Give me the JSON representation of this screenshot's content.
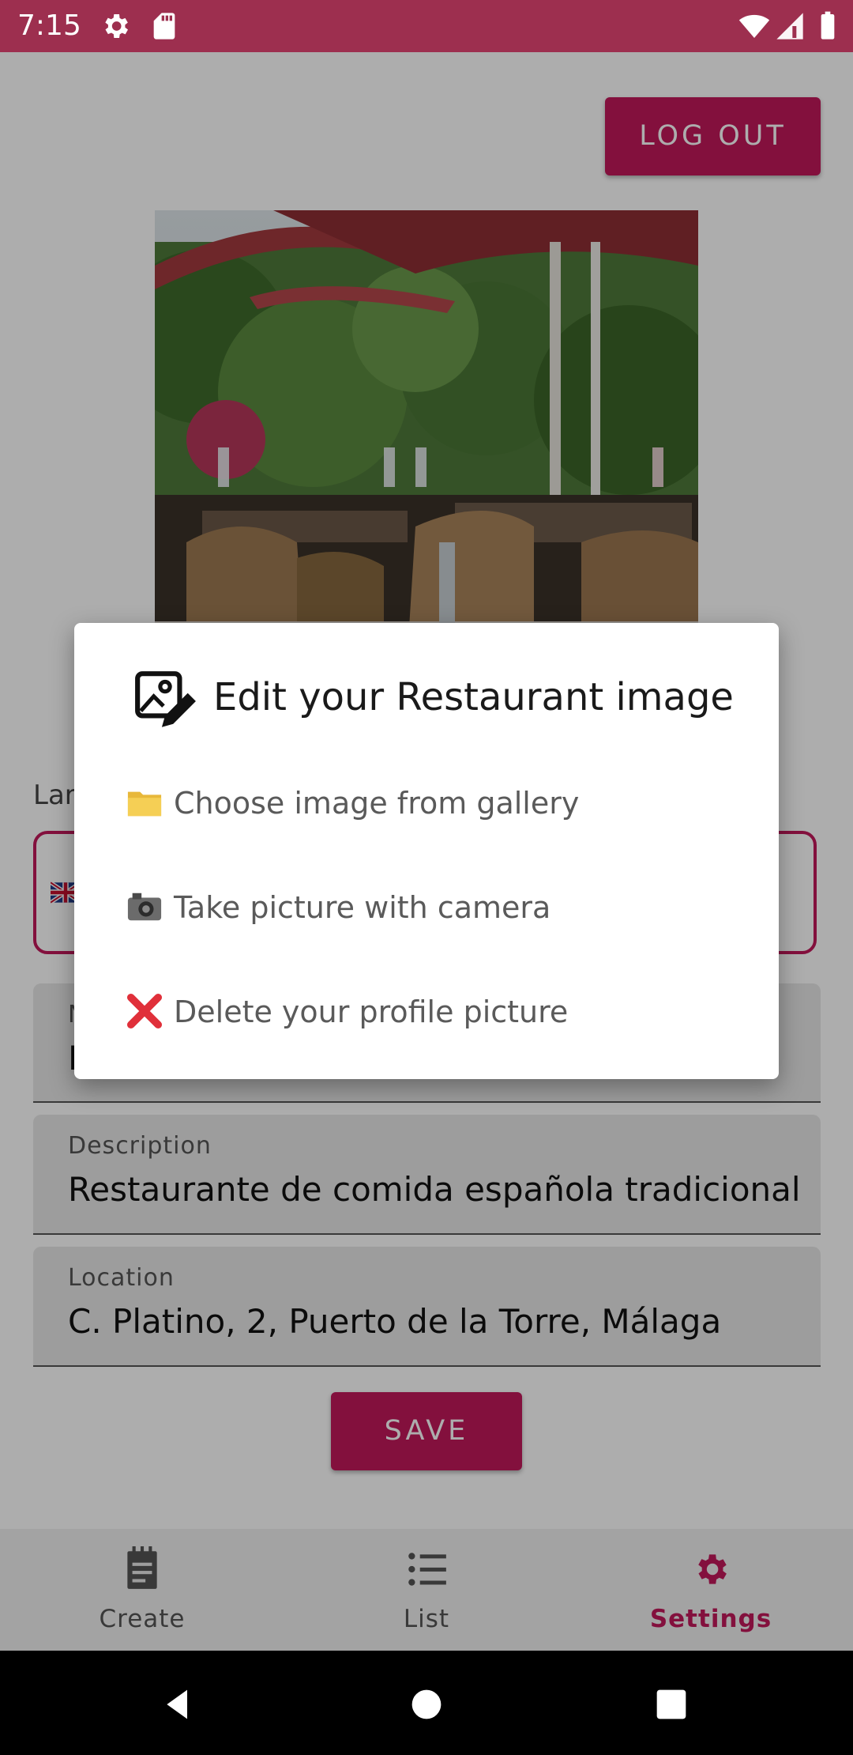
{
  "status_bar": {
    "time": "7:15",
    "icons": [
      "settings-gear-icon",
      "sd-card-icon",
      "wifi-icon",
      "cellular-signal-icon",
      "battery-icon"
    ]
  },
  "header": {
    "logout_label": "LOG OUT"
  },
  "profile": {
    "image_alt": "restaurant-terrace-photo"
  },
  "language": {
    "label": "Lar",
    "flag": "uk-flag-icon"
  },
  "fields": {
    "name_label": "N",
    "name_value": "F",
    "description_label": "Description",
    "description_value": "Restaurante de comida española tradicional",
    "location_label": "Location",
    "location_value": "C. Platino, 2, Puerto de la Torre, Málaga"
  },
  "save_label": "SAVE",
  "dialog": {
    "title": "Edit your Restaurant image",
    "options": [
      {
        "icon": "folder-icon",
        "label": "Choose image from gallery"
      },
      {
        "icon": "camera-icon",
        "label": "Take picture with camera"
      },
      {
        "icon": "red-x-icon",
        "label": "Delete your profile picture"
      }
    ]
  },
  "bottom_nav": {
    "items": [
      {
        "label": "Create",
        "icon": "notepad-icon",
        "active": false
      },
      {
        "label": "List",
        "icon": "list-icon",
        "active": false
      },
      {
        "label": "Settings",
        "icon": "gear-icon",
        "active": true
      }
    ]
  },
  "colors": {
    "accent": "#c2185b",
    "status_bar": "#9d2f4f"
  }
}
